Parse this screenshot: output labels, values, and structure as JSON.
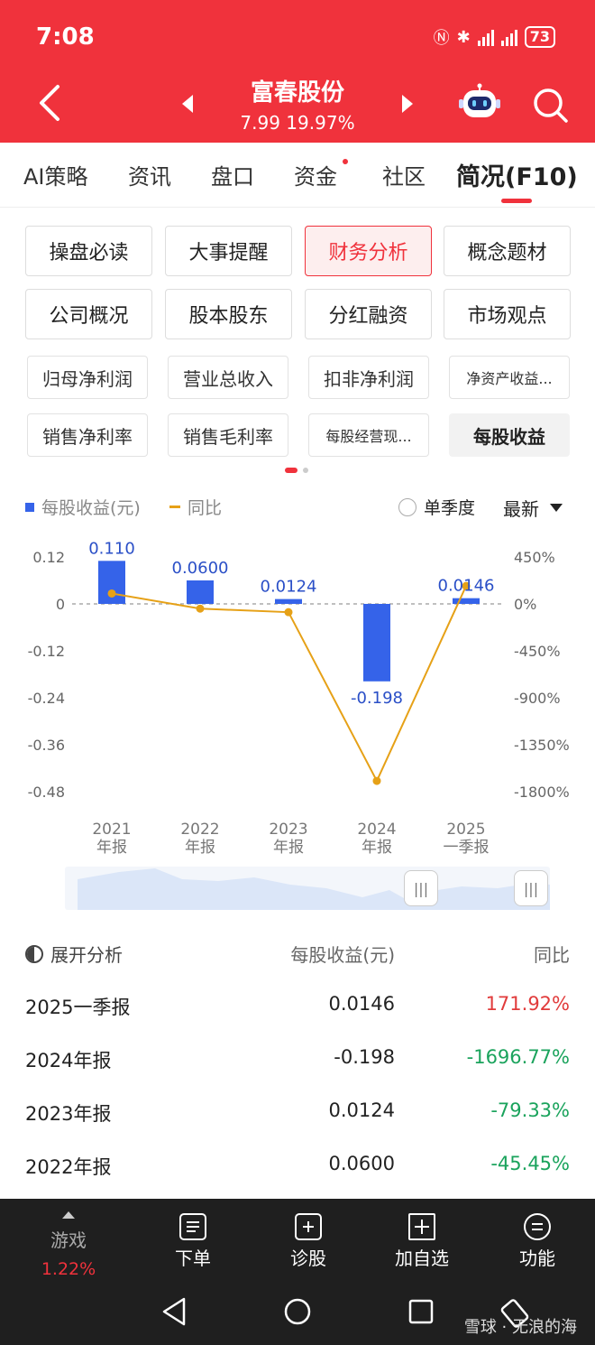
{
  "status": {
    "time": "7:08",
    "battery": "73"
  },
  "header": {
    "stock_name": "富春股份",
    "stock_price": "7.99 19.97%"
  },
  "tabs": [
    {
      "label": "AI策略"
    },
    {
      "label": "资讯"
    },
    {
      "label": "盘口"
    },
    {
      "label": "资金"
    },
    {
      "label": "社区"
    },
    {
      "label": "简况(F10)"
    }
  ],
  "grid_buttons": [
    "操盘必读",
    "大事提醒",
    "财务分析",
    "概念题材",
    "公司概况",
    "股本股东",
    "分红融资",
    "市场观点"
  ],
  "metric_buttons": [
    "归母净利润",
    "营业总收入",
    "扣非净利润",
    "净资产收益...",
    "销售净利率",
    "销售毛利率",
    "每股经营现...",
    "每股收益"
  ],
  "legend": {
    "bar": "每股收益(元)",
    "line": "同比",
    "quarter": "单季度",
    "period": "最新"
  },
  "chart_data": {
    "type": "bar",
    "categories": [
      "2021\n年报",
      "2022\n年报",
      "2023\n年报",
      "2024\n年报",
      "2025\n一季报"
    ],
    "series": [
      {
        "name": "每股收益(元)",
        "values": [
          0.11,
          0.06,
          0.0124,
          -0.198,
          0.0146
        ],
        "labels": [
          "0.110",
          "0.0600",
          "0.0124",
          "-0.198",
          "0.0146"
        ],
        "color": "#3563e9"
      },
      {
        "name": "同比",
        "values": [
          100,
          -45.45,
          -79.33,
          -1696.77,
          171.92
        ],
        "color": "#e6a117"
      }
    ],
    "y_left_ticks": [
      "0.12",
      "0",
      "-0.12",
      "-0.24",
      "-0.36",
      "-0.48"
    ],
    "y_right_ticks": [
      "450%",
      "0%",
      "-450%",
      "-900%",
      "-1350%",
      "-1800%"
    ],
    "ylim_left": [
      -0.48,
      0.12
    ],
    "ylim_right": [
      -1800,
      450
    ]
  },
  "table": {
    "expand_label": "展开分析",
    "col_eps": "每股收益(元)",
    "col_yoy": "同比",
    "rows": [
      {
        "period": "2025一季报",
        "eps": "0.0146",
        "yoy": "171.92%",
        "dir": "up"
      },
      {
        "period": "2024年报",
        "eps": "-0.198",
        "yoy": "-1696.77%",
        "dir": "down"
      },
      {
        "period": "2023年报",
        "eps": "0.0124",
        "yoy": "-79.33%",
        "dir": "down"
      },
      {
        "period": "2022年报",
        "eps": "0.0600",
        "yoy": "-45.45%",
        "dir": "down"
      }
    ]
  },
  "bottom_bar": {
    "game": "游戏",
    "game_pct": "1.22%",
    "order": "下单",
    "diagnose": "诊股",
    "add_watch": "加自选",
    "functions": "功能"
  },
  "watermark": "雪球 · 无浪的海"
}
